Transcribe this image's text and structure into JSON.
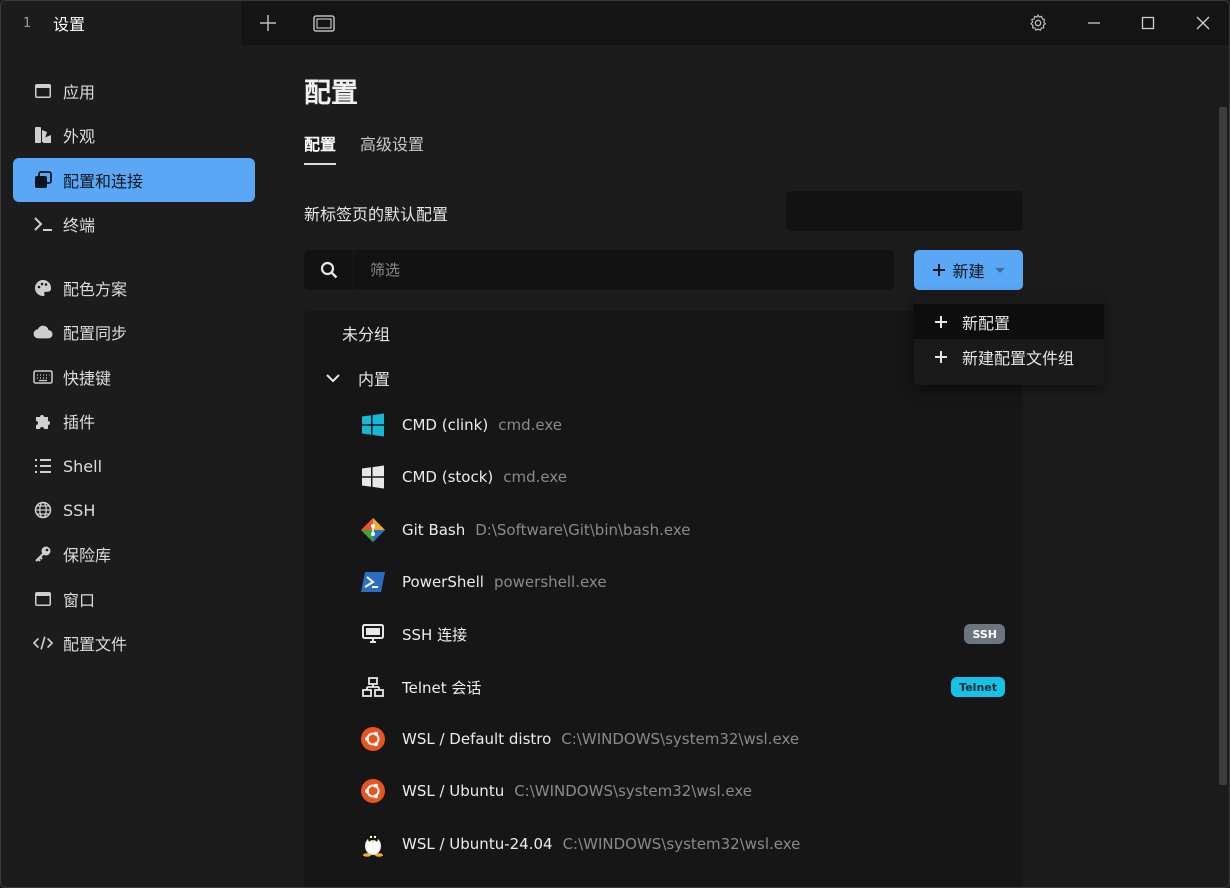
{
  "titlebar": {
    "tab_index": "1",
    "tab_title": "设置"
  },
  "sidebar": {
    "items": [
      {
        "label": "应用",
        "icon": "app-window-icon"
      },
      {
        "label": "外观",
        "icon": "paint-swatch-icon"
      },
      {
        "label": "配置和连接",
        "icon": "window-stack-icon",
        "active": true
      },
      {
        "label": "终端",
        "icon": "terminal-prompt-icon"
      },
      {
        "label": "配色方案",
        "icon": "palette-icon"
      },
      {
        "label": "配置同步",
        "icon": "cloud-icon"
      },
      {
        "label": "快捷键",
        "icon": "keyboard-icon"
      },
      {
        "label": "插件",
        "icon": "puzzle-icon"
      },
      {
        "label": "Shell",
        "icon": "list-icon"
      },
      {
        "label": "SSH",
        "icon": "globe-icon"
      },
      {
        "label": "保险库",
        "icon": "key-icon"
      },
      {
        "label": "窗口",
        "icon": "window-icon"
      },
      {
        "label": "配置文件",
        "icon": "code-icon"
      }
    ]
  },
  "main": {
    "title": "配置",
    "tabs": [
      {
        "label": "配置",
        "active": true
      },
      {
        "label": "高级设置",
        "active": false
      }
    ],
    "default_profile_label": "新标签页的默认配置",
    "filter_placeholder": "筛选",
    "new_button_label": "新建",
    "dropdown": [
      {
        "label": "新配置"
      },
      {
        "label": "新建配置文件组"
      }
    ],
    "groups": {
      "ungrouped": "未分组",
      "builtin": "内置"
    },
    "profiles": [
      {
        "name": "CMD (clink)",
        "cmd": "cmd.exe",
        "icon": "windows-logo-icon"
      },
      {
        "name": "CMD (stock)",
        "cmd": "cmd.exe",
        "icon": "windows-logo-icon"
      },
      {
        "name": "Git Bash",
        "cmd": "D:\\Software\\Git\\bin\\bash.exe",
        "icon": "git-logo-icon"
      },
      {
        "name": "PowerShell",
        "cmd": "powershell.exe",
        "icon": "powershell-icon"
      },
      {
        "name": "SSH 连接",
        "cmd": "",
        "icon": "monitor-icon",
        "badge": "SSH"
      },
      {
        "name": "Telnet 会话",
        "cmd": "",
        "icon": "network-icon",
        "badge": "Telnet"
      },
      {
        "name": "WSL / Default distro",
        "cmd": "C:\\WINDOWS\\system32\\wsl.exe",
        "icon": "ubuntu-icon"
      },
      {
        "name": "WSL / Ubuntu",
        "cmd": "C:\\WINDOWS\\system32\\wsl.exe",
        "icon": "ubuntu-icon"
      },
      {
        "name": "WSL / Ubuntu-24.04",
        "cmd": "C:\\WINDOWS\\system32\\wsl.exe",
        "icon": "linux-tux-icon"
      }
    ]
  },
  "colors": {
    "accent": "#5aa8f5",
    "windows_cyan": "#17b8d6",
    "ubuntu_orange": "#e95420",
    "telnet_badge": "#17c2e8",
    "ssh_badge": "#6c757d"
  }
}
